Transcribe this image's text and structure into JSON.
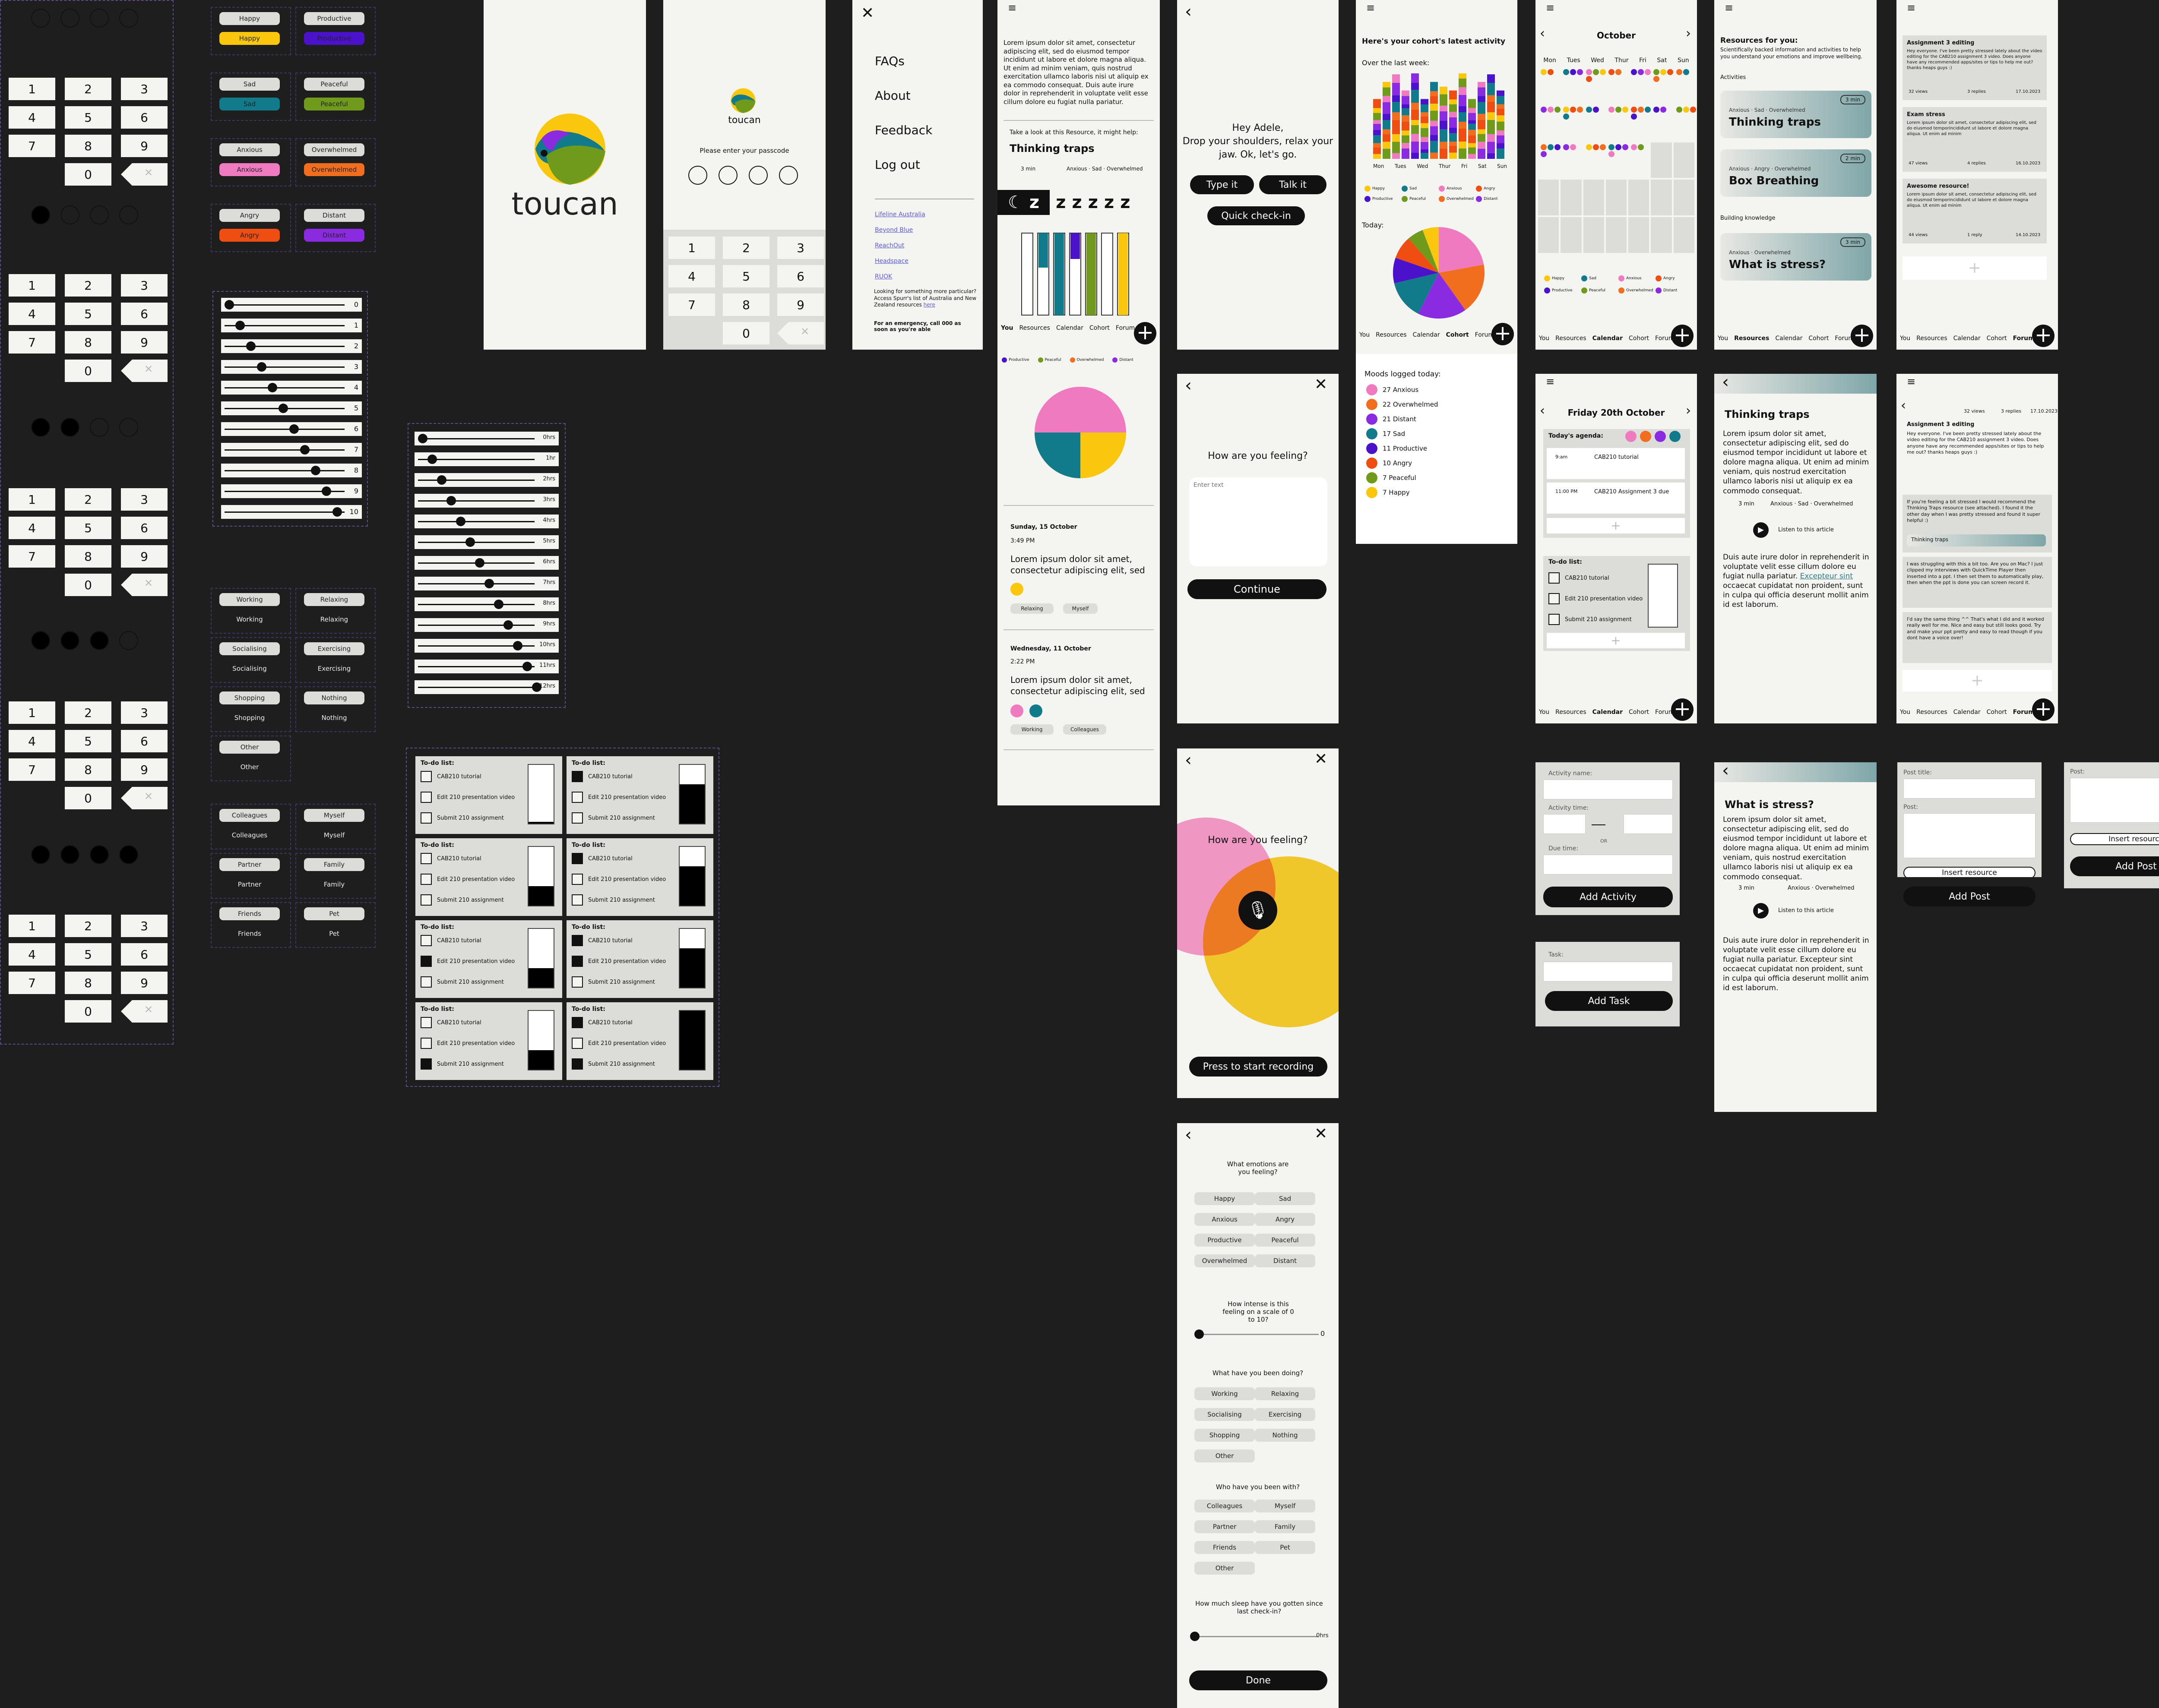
{
  "colors": {
    "happy": "#f9c80e",
    "sad": "#117a8b",
    "productive": "#4b12cc",
    "peaceful": "#6f9a1c",
    "anxious": "#ef7ac0",
    "overwhelmed": "#f06e1e",
    "distant": "#8a2be2",
    "angry": "#ef4e12"
  },
  "keypad": {
    "keys": [
      "1",
      "2",
      "3",
      "4",
      "5",
      "6",
      "7",
      "8",
      "9",
      "0"
    ]
  },
  "emotion_pills": [
    {
      "a": "Happy",
      "b": "Productive"
    },
    {
      "a": "Sad",
      "b": "Peaceful"
    },
    {
      "a": "Anxious",
      "b": "Overwhelmed"
    },
    {
      "a": "Angry",
      "b": "Distant"
    }
  ],
  "activity_pills": [
    {
      "a": "Working",
      "b": "Relaxing"
    },
    {
      "a": "Socialising",
      "b": "Exercising"
    },
    {
      "a": "Shopping",
      "b": "Nothing"
    },
    {
      "a": "Other",
      "b": ""
    }
  ],
  "people_pills": [
    {
      "a": "Colleagues",
      "b": "Myself"
    },
    {
      "a": "Partner",
      "b": "Family"
    },
    {
      "a": "Friends",
      "b": "Pet"
    }
  ],
  "intensity_values": [
    "0",
    "1",
    "2",
    "3",
    "4",
    "5",
    "6",
    "7",
    "8",
    "9",
    "10"
  ],
  "sleep_values": [
    "0hrs",
    "1hr",
    "2hrs",
    "3hrs",
    "4hrs",
    "5hrs",
    "6hrs",
    "7hrs",
    "8hrs",
    "9hrs",
    "10hrs",
    "11hrs",
    "12hrs"
  ],
  "todo": {
    "title": "To-do list:",
    "items": [
      "CAB210 tutorial",
      "Edit 210 presentation video",
      "Submit 210 assignment"
    ]
  },
  "splash": {
    "brand": "toucan"
  },
  "passcode": {
    "brand": "toucan",
    "prompt": "Please enter your passcode"
  },
  "menu": {
    "items": [
      "FAQs",
      "About",
      "Feedback",
      "Log out"
    ],
    "links": [
      "Lifeline Australia",
      "Beyond Blue",
      "ReachOut",
      "Headspace",
      "RUOK"
    ],
    "looking": "Looking for something more particular? Access Spurr's list of Australia and New Zealand resources",
    "here": "here",
    "emergency": "For an emergency, call 000 as soon as you're able"
  },
  "you": {
    "lorem": "Lorem ipsum dolor sit amet, consectetur adipiscing elit, sed do eiusmod tempor incididunt ut labore et dolore magna aliqua. Ut enim ad minim veniam, quis nostrud exercitation ullamco laboris nisi ut aliquip ex ea commodo consequat. Duis aute irure dolor in reprehenderit in voluptate velit esse cillum dolore eu fugiat nulla pariatur.",
    "take": "Take a look at this Resource, it might help:",
    "res": "Thinking traps",
    "res_time": "3 min",
    "res_tags": "Anxious · Sad · Overwhelmed",
    "day1": "Sunday, 15 October",
    "time1": "3:49 PM",
    "entry": "Lorem ipsum dolor sit amet, consectetur adipiscing elit, sed",
    "tag1a": "Relaxing",
    "tag1b": "Myself",
    "day2": "Wednesday, 11 October",
    "time2": "2:22 PM",
    "tag2a": "Working",
    "tag2b": "Colleagues",
    "legend": [
      "Productive",
      "Peaceful",
      "Overwhelmed",
      "Distant"
    ]
  },
  "nav": {
    "you": "You",
    "resources": "Resources",
    "calendar": "Calendar",
    "cohort": "Cohort",
    "forum": "Forum"
  },
  "greet": {
    "text": "Hey Adele,\nDrop your shoulders, relax your jaw. Ok, let's go.",
    "type": "Type it",
    "talk": "Talk it",
    "quick": "Quick check-in"
  },
  "feel": {
    "q": "How are you feeling?",
    "placeholder": "Enter text",
    "cont": "Continue",
    "record": "Press to start recording"
  },
  "checkin": {
    "q1": "What emotions are you feeling?",
    "emotions": [
      "Happy",
      "Sad",
      "Anxious",
      "Angry",
      "Productive",
      "Peaceful",
      "Overwhelmed",
      "Distant"
    ],
    "q2": "How intense is this feeling on a scale of 0 to 10?",
    "v2": "0",
    "q3": "What have you been doing?",
    "acts": [
      "Working",
      "Relaxing",
      "Socialising",
      "Exercising",
      "Shopping",
      "Nothing",
      "Other"
    ],
    "q4": "Who have you been with?",
    "people": [
      "Colleagues",
      "Myself",
      "Partner",
      "Family",
      "Friends",
      "Pet",
      "Other"
    ],
    "q5": "How much sleep have you gotten since last check-in?",
    "v5": "0hrs",
    "done": "Done"
  },
  "cohort": {
    "title": "Here's your cohort's latest activity",
    "week": "Over the last week:",
    "days": [
      "Mon",
      "Tues",
      "Wed",
      "Thur",
      "Fri",
      "Sat",
      "Sun"
    ],
    "today": "Today:",
    "legend": [
      "Happy",
      "Sad",
      "Anxious",
      "Angry",
      "Productive",
      "Peaceful",
      "Overwhelmed",
      "Distant"
    ],
    "moods_title": "Moods logged today:",
    "moods": [
      "27 Anxious",
      "22 Overwhelmed",
      "21 Distant",
      "17 Sad",
      "11 Productive",
      "10 Angry",
      "7 Peaceful",
      "7 Happy"
    ]
  },
  "calendar": {
    "month": "October",
    "days": [
      "Mon",
      "Tues",
      "Wed",
      "Thur",
      "Fri",
      "Sat",
      "Sun"
    ],
    "friday": "Friday 20th October",
    "agenda": "Today's agenda:",
    "a1t": "9:am",
    "a1": "CAB210 tutorial",
    "a2t": "11:00 PM",
    "a2": "CAB210 Assignment 3 due",
    "legend": [
      "Happy",
      "Sad",
      "Anxious",
      "Angry",
      "Productive",
      "Peaceful",
      "Overwhelmed",
      "Distant"
    ]
  },
  "resources": {
    "title": "Resources for you:",
    "sub": "Scientifically backed information and activities to help you understand your emotions and improve wellbeing.",
    "activities": "Activities",
    "building": "Building knowledge",
    "cards": [
      {
        "tags": "Anxious · Sad · Overwhelmed",
        "name": "Thinking traps",
        "time": "3 min"
      },
      {
        "tags": "Anxious · Angry · Overwhelmed",
        "name": "Box Breathing",
        "time": "2 min"
      },
      {
        "tags": "Anxious · Overwhelmed",
        "name": "What is stress?",
        "time": "3 min"
      }
    ]
  },
  "forum": {
    "posts": [
      {
        "title": "Assignment 3 editing",
        "body": "Hey everyone. I've been pretty stressed lately about the video editing for the CAB210 assignment 3 video. Does anyone have any recommended apps/sites or tips to help me out? thanks heaps guys :)",
        "views": "32 views",
        "replies": "3 replies",
        "date": "17.10.2023"
      },
      {
        "title": "Exam stress",
        "body": "Lorem ipsum dolor sit amet, consectetur adipiscing elit, sed do eiusmod temporincididunt ut labore et dolore magna aliqua. Ut enim ad minim",
        "views": "47 views",
        "replies": "4 replies",
        "date": "16.10.2023"
      },
      {
        "title": "Awesome resource!",
        "body": "Lorem ipsum dolor sit amet, consectetur adipiscing elit, sed do eiusmod temporincididunt ut labore et dolore magna aliqua. Ut enim ad minim",
        "views": "44 views",
        "replies": "1 reply",
        "date": "14.10.2023"
      }
    ],
    "thread_views": "32 views",
    "thread_replies": "3 replies",
    "thread_date": "17.10.2023",
    "thread_title": "Assignment 3 editing",
    "thread_body": "Hey everyone. I've been pretty stressed lately about the video editing for the CAB210 assignment 3 video. Does anyone have any recommended apps/sites or tips to help me out? thanks heaps guys :)",
    "r1": "If you're feeling a bit stressed I would recommend the Thinking Traps resource (see attached). I found it the other day when I was pretty stressed and found it super helpful :)",
    "r1res": "Thinking traps",
    "r2": "I was struggling with this a bit too. Are you on Mac? I just clipped my interviews with QuickTime Player then inserted into a ppt. I then set them to automatically play, then when the ppt is done you can screen record it.",
    "r3": "I'd say the same thing ^^ That's what I did and it worked really well for me. Nice and easy but still looks good. Try and make your ppt pretty and easy to read though if you dont have a voice over!"
  },
  "article": {
    "t1": "Thinking traps",
    "t2": "What is stress?",
    "p1": "Lorem ipsum dolor sit amet, consectetur adipiscing elit, sed do eiusmod tempor incididunt ut labore et dolore magna aliqua. Ut enim ad minim veniam, quis nostrud exercitation ullamco laboris nisi ut aliquip ex ea commodo consequat.",
    "time": "3 min",
    "tags1": "Anxious · Sad · Overwhelmed",
    "tags2": "Anxious · Overwhelmed",
    "listen": "Listen to this article",
    "p2a": "Duis aute irure dolor in reprehenderit in voluptate velit esse cillum dolore eu fugiat nulla pariatur.",
    "link": "Excepteur sint",
    "p2b": "occaecat cupidatat non proident, sunt in culpa qui officia deserunt mollit anim id est laborum.",
    "p3": "Duis aute irure dolor in reprehenderit in voluptate velit esse cillum dolore eu fugiat nulla pariatur. Excepteur sint occaecat cupidatat non proident, sunt in culpa qui officia deserunt mollit anim id est laborum."
  },
  "forms": {
    "act_name": "Activity name:",
    "act_time": "Activity time:",
    "or": "OR",
    "due": "Due time:",
    "add_act": "Add Activity",
    "task": "Task:",
    "add_task": "Add Task",
    "post_title": "Post title:",
    "post": "Post:",
    "insert": "Insert resource",
    "add_post": "Add Post"
  }
}
